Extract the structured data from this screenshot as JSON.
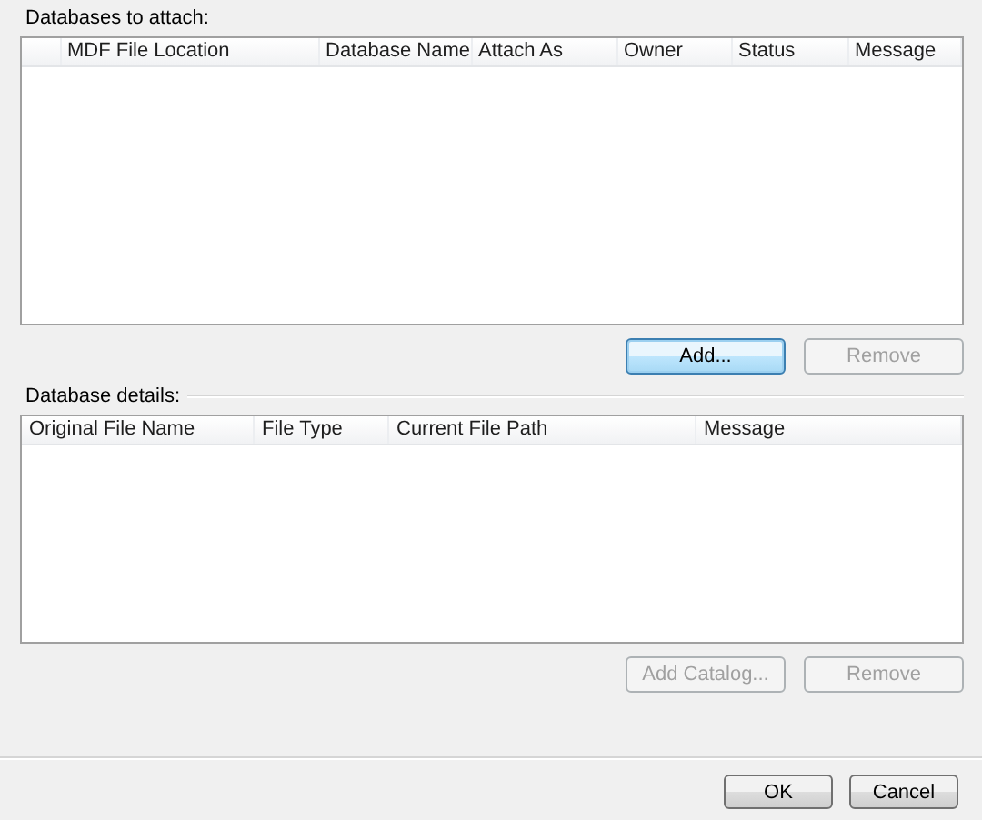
{
  "attach_section": {
    "label": "Databases to attach:",
    "table": {
      "columns": [
        "",
        "MDF File Location",
        "Database Name",
        "Attach As",
        "Owner",
        "Status",
        "Message"
      ]
    },
    "buttons": [
      {
        "label": "Add...",
        "disabled": false,
        "focused": true
      },
      {
        "label": "Remove",
        "disabled": true,
        "focused": false
      }
    ]
  },
  "details_section": {
    "label": "Database details:",
    "table": {
      "columns": [
        "Original File Name",
        "File Type",
        "Current File Path",
        "Message"
      ]
    },
    "buttons": [
      {
        "label": "Add Catalog...",
        "disabled": true,
        "focused": false
      },
      {
        "label": "Remove",
        "disabled": true,
        "focused": false
      }
    ]
  },
  "footer_buttons": [
    {
      "label": "OK",
      "disabled": false,
      "focused": false
    },
    {
      "label": "Cancel",
      "disabled": false,
      "focused": false
    }
  ]
}
